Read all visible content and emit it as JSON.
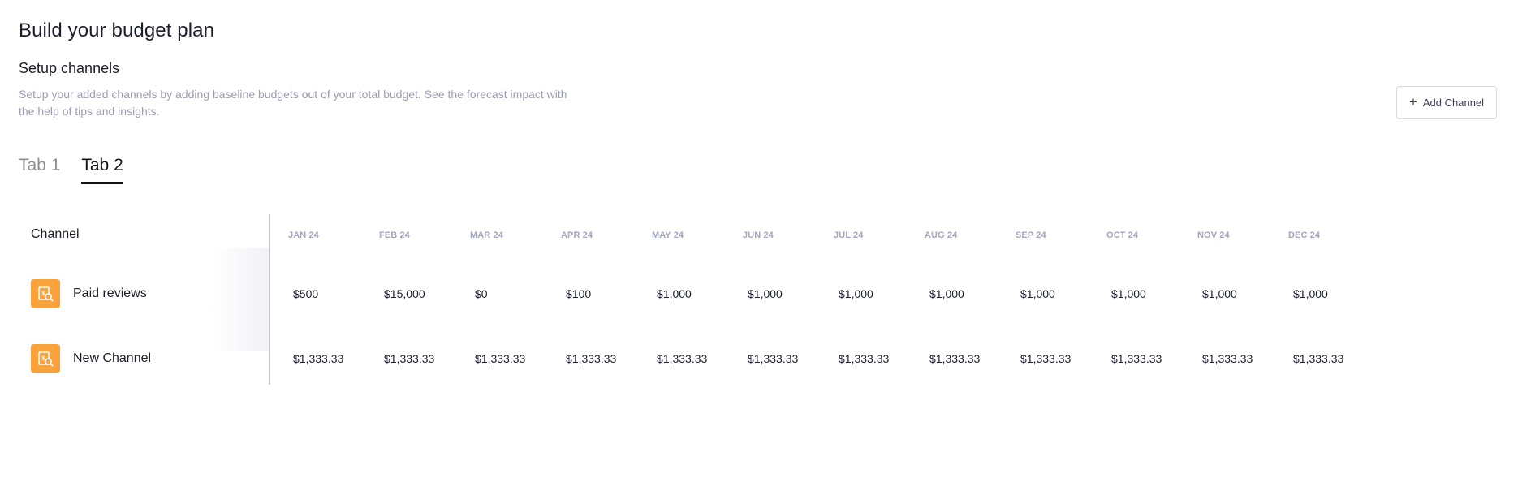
{
  "header": {
    "title": "Build your budget plan",
    "section_title": "Setup channels",
    "description": "Setup your added channels by adding baseline budgets out of your total budget. See the forecast impact with the help of tips and insights."
  },
  "actions": {
    "add_channel_label": "Add Channel",
    "add_channel_icon": "plus-icon"
  },
  "tabs": [
    {
      "label": "Tab 1",
      "active": false
    },
    {
      "label": "Tab 2",
      "active": true
    }
  ],
  "table": {
    "channel_header": "Channel",
    "months": [
      "JAN 24",
      "FEB 24",
      "MAR 24",
      "APR 24",
      "MAY 24",
      "JUN 24",
      "JUL 24",
      "AUG 24",
      "SEP 24",
      "OCT 24",
      "NOV 24",
      "DEC 24"
    ],
    "rows": [
      {
        "name": "Paid reviews",
        "icon": "budget-search-icon",
        "values": [
          "$500",
          "$15,000",
          "$0",
          "$100",
          "$1,000",
          "$1,000",
          "$1,000",
          "$1,000",
          "$1,000",
          "$1,000",
          "$1,000",
          "$1,000"
        ]
      },
      {
        "name": "New Channel",
        "icon": "budget-search-icon",
        "values": [
          "$1,333.33",
          "$1,333.33",
          "$1,333.33",
          "$1,333.33",
          "$1,333.33",
          "$1,333.33",
          "$1,333.33",
          "$1,333.33",
          "$1,333.33",
          "$1,333.33",
          "$1,333.33",
          "$1,333.33"
        ]
      }
    ]
  },
  "colors": {
    "channel_icon_bg": "#f7a23a",
    "muted_text": "#9a9cb1",
    "month_header": "#a3a6bd"
  }
}
